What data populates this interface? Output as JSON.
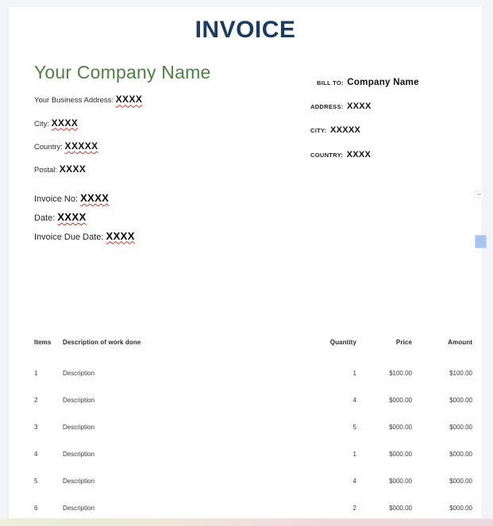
{
  "document": {
    "title": "INVOICE"
  },
  "seller": {
    "company_name": "Your Company Name",
    "lines": [
      {
        "label": "Your Business Address:",
        "value": "XXXX",
        "misspelled": true
      },
      {
        "label": "City:",
        "value": "XXXX",
        "misspelled": true
      },
      {
        "label": "Country:",
        "value": "XXXXX",
        "misspelled": true
      },
      {
        "label": "Postal:",
        "value": "XXXX",
        "misspelled": false
      }
    ]
  },
  "buyer": {
    "lines": [
      {
        "label": "BILL TO:",
        "value": "Company Name"
      },
      {
        "label": "ADDRESS:",
        "value": "XXXX"
      },
      {
        "label": "CITY:",
        "value": "XXXXX"
      },
      {
        "label": "COUNTRY:",
        "value": "XXXX"
      }
    ]
  },
  "invoice_meta": {
    "lines": [
      {
        "label": "Invoice No:",
        "value": "XXXX"
      },
      {
        "label": "Date:",
        "value": "XXXX"
      },
      {
        "label": "Invoice Due Date:",
        "value": "XXXX"
      }
    ]
  },
  "items_table": {
    "headers": [
      "Items",
      "Description of work done",
      "Quantity",
      "Price",
      "Amount"
    ],
    "rows": [
      {
        "item": "1",
        "description": "Description",
        "quantity": "1",
        "price": "$100.00",
        "amount": "$100.00"
      },
      {
        "item": "2",
        "description": "Description",
        "quantity": "4",
        "price": "$000.00",
        "amount": "$000.00"
      },
      {
        "item": "3",
        "description": "Description",
        "quantity": "5",
        "price": "$000.00",
        "amount": "$000.00"
      },
      {
        "item": "4",
        "description": "Description",
        "quantity": "1",
        "price": "$000.00",
        "amount": "$000.00"
      },
      {
        "item": "5",
        "description": "Description",
        "quantity": "4",
        "price": "$000.00",
        "amount": "$000.00"
      },
      {
        "item": "6",
        "description": "Description",
        "quantity": "2",
        "price": "$000.00",
        "amount": "$000.00"
      }
    ]
  },
  "colors": {
    "title_navy": "#1b3c61",
    "company_green": "#4e8041",
    "spellcheck_red": "#d93025",
    "selection_blue": "#a8c5ef",
    "page_white": "#ffffff",
    "chrome_gray": "#f1f3f5"
  }
}
